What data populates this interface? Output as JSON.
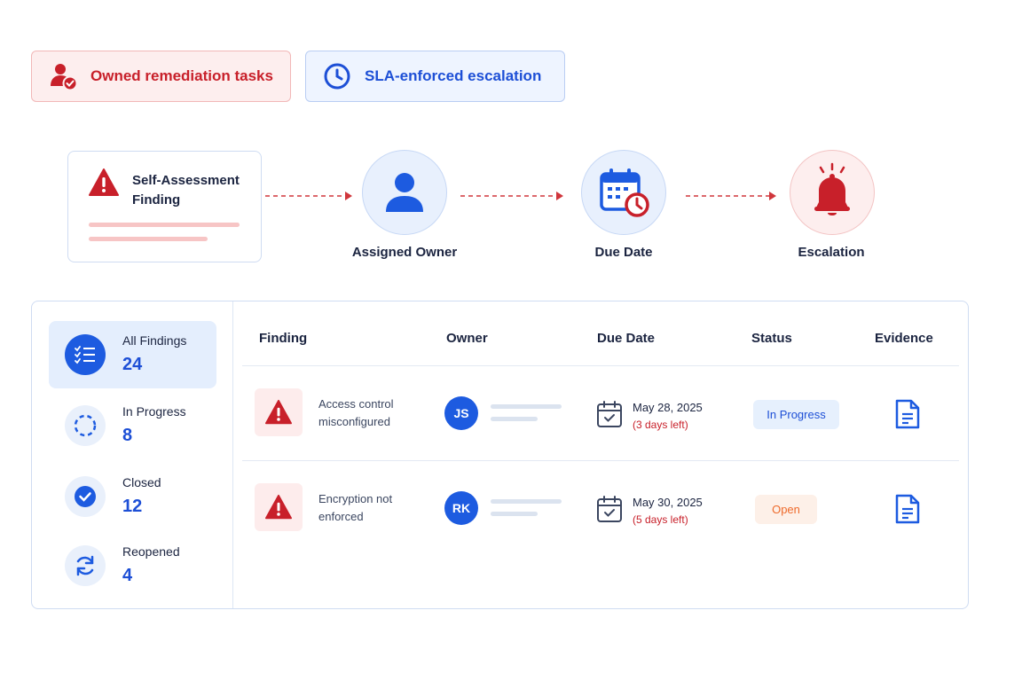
{
  "pills": {
    "owned_label": "Owned remediation tasks",
    "sla_label": "SLA-enforced escalation"
  },
  "flow": {
    "finding_title": "Self-Assessment Finding",
    "steps": [
      {
        "label": "Assigned Owner",
        "icon": "person-icon"
      },
      {
        "label": "Due Date",
        "icon": "calendar-clock-icon"
      },
      {
        "label": "Escalation",
        "icon": "bell-icon"
      }
    ]
  },
  "sidebar": {
    "items": [
      {
        "label": "All Findings",
        "count": "24",
        "icon": "checklist-icon",
        "active": true
      },
      {
        "label": "In Progress",
        "count": "8",
        "icon": "dashed-circle-icon"
      },
      {
        "label": "Closed",
        "count": "12",
        "icon": "check-circle-icon"
      },
      {
        "label": "Reopened",
        "count": "4",
        "icon": "refresh-icon"
      }
    ]
  },
  "table": {
    "headers": {
      "finding": "Finding",
      "owner": "Owner",
      "due_date": "Due Date",
      "status": "Status",
      "evidence": "Evidence"
    },
    "rows": [
      {
        "finding_line1": "Access control",
        "finding_line2": "misconfigured",
        "owner_initials": "JS",
        "due_date": "May 28, 2025",
        "due_left": "(3 days left)",
        "status": "In Progress"
      },
      {
        "finding_line1": "Encryption not",
        "finding_line2": "enforced",
        "owner_initials": "RK",
        "due_date": "May 30, 2025",
        "due_left": "(5 days left)",
        "status": "Open"
      }
    ]
  },
  "colors": {
    "accent_blue": "#1d4fd6",
    "accent_red": "#c8202a",
    "status_open": "#ee6a2b"
  }
}
